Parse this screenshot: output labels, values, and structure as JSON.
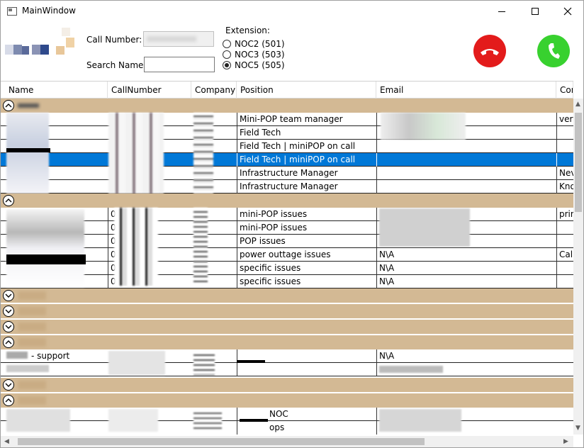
{
  "window": {
    "title": "MainWindow"
  },
  "header": {
    "call_number_label": "Call Number:",
    "search_name_label": "Search Name:",
    "extension_label": "Extension:",
    "radios": [
      "NOC2 (501)",
      "NOC3 (503)",
      "NOC5 (505)"
    ],
    "selected_radio": "NOC5 (505)",
    "search_value": ""
  },
  "columns": [
    "Name",
    "CallNumber",
    "Company",
    "Position",
    "Email",
    "Cor"
  ],
  "groups": [
    {
      "rows": [
        {
          "position": "Mini-POP team manager",
          "extra": "very"
        },
        {
          "position": "Field Tech",
          "extra": ""
        },
        {
          "position": "Field Tech | miniPOP on call",
          "extra": ""
        },
        {
          "position": "Field Tech | miniPOP on call",
          "extra": "",
          "selected": true
        },
        {
          "position": "Infrastructure Manager",
          "extra": "Nev"
        },
        {
          "position": "Infrastructure Manager",
          "extra": "Kno"
        }
      ]
    },
    {
      "rows": [
        {
          "position": "mini-POP issues",
          "email": "",
          "extra": "prin",
          "call_prefix": "0"
        },
        {
          "position": "mini-POP issues",
          "email": "",
          "extra": "",
          "call_prefix": "0"
        },
        {
          "position": "POP issues",
          "email": "",
          "extra": "",
          "call_prefix": "0"
        },
        {
          "position": "power outtage issues",
          "email": "N\\A",
          "extra": "Call",
          "call_prefix": "0"
        },
        {
          "position": "specific issues",
          "email": "N\\A",
          "extra": "",
          "call_prefix": "0"
        },
        {
          "position": "specific issues",
          "email": "N\\A",
          "extra": "",
          "call_prefix": "0"
        }
      ]
    }
  ],
  "support_rows": [
    {
      "name_suffix": "- support",
      "email": "N\\A"
    },
    {
      "name_suffix": "",
      "email": ""
    }
  ],
  "noc_rows": [
    {
      "position": "NOC"
    },
    {
      "position": "ops"
    }
  ]
}
